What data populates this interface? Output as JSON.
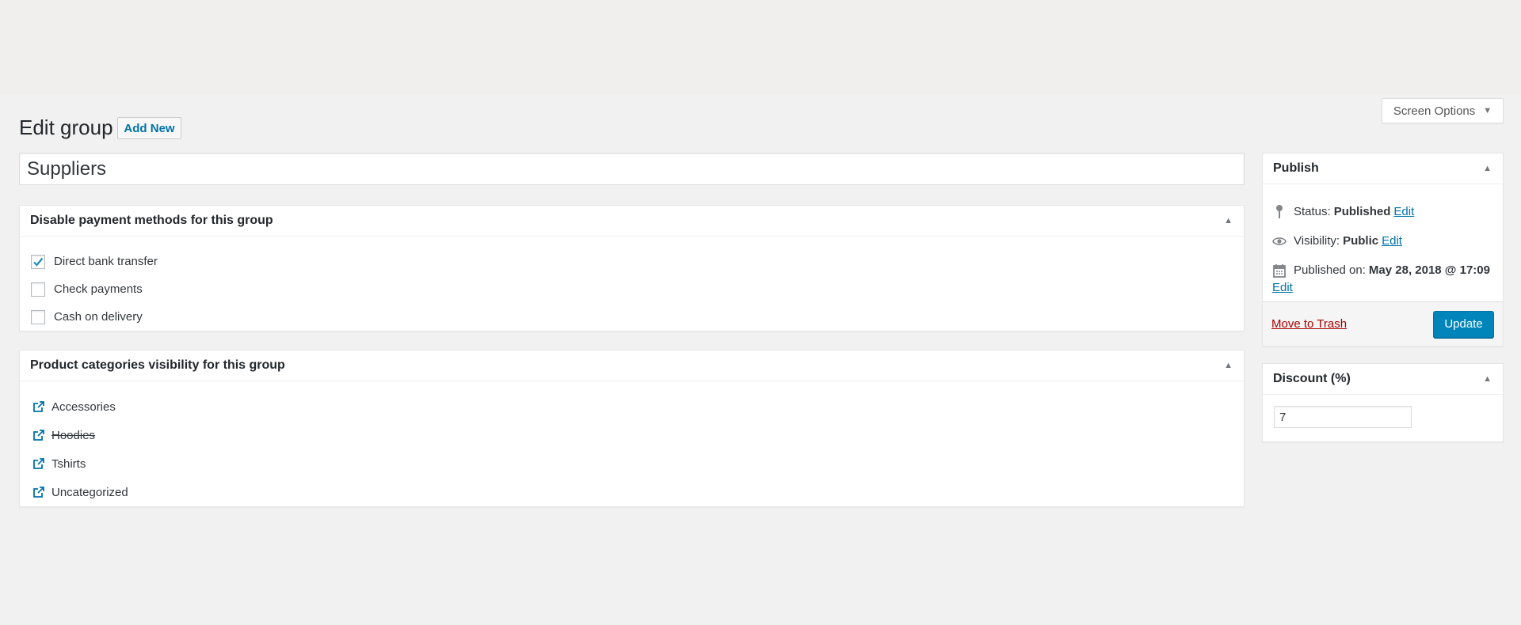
{
  "header": {
    "screen_options_label": "Screen Options",
    "page_title": "Edit group",
    "add_new_label": "Add New"
  },
  "title_field": {
    "value": "Suppliers"
  },
  "payment_methods": {
    "title": "Disable payment methods for this group",
    "items": [
      {
        "label": "Direct bank transfer",
        "checked": true
      },
      {
        "label": "Check payments",
        "checked": false
      },
      {
        "label": "Cash on delivery",
        "checked": false
      }
    ]
  },
  "product_categories": {
    "title": "Product categories visibility for this group",
    "items": [
      {
        "label": "Accessories",
        "hidden": false
      },
      {
        "label": "Hoodies",
        "hidden": true
      },
      {
        "label": "Tshirts",
        "hidden": false
      },
      {
        "label": "Uncategorized",
        "hidden": false
      }
    ]
  },
  "publish": {
    "title": "Publish",
    "status_label": "Status:",
    "status_value": "Published",
    "visibility_label": "Visibility:",
    "visibility_value": "Public",
    "published_label": "Published on:",
    "published_value": "May 28, 2018 @ 17:09",
    "edit_label": "Edit",
    "trash_label": "Move to Trash",
    "update_label": "Update"
  },
  "discount": {
    "title": "Discount (%)",
    "value": "7"
  },
  "colors": {
    "accent": "#0073aa",
    "primary_button": "#0085ba",
    "danger": "#aa0000",
    "background": "#f1f1f1"
  }
}
